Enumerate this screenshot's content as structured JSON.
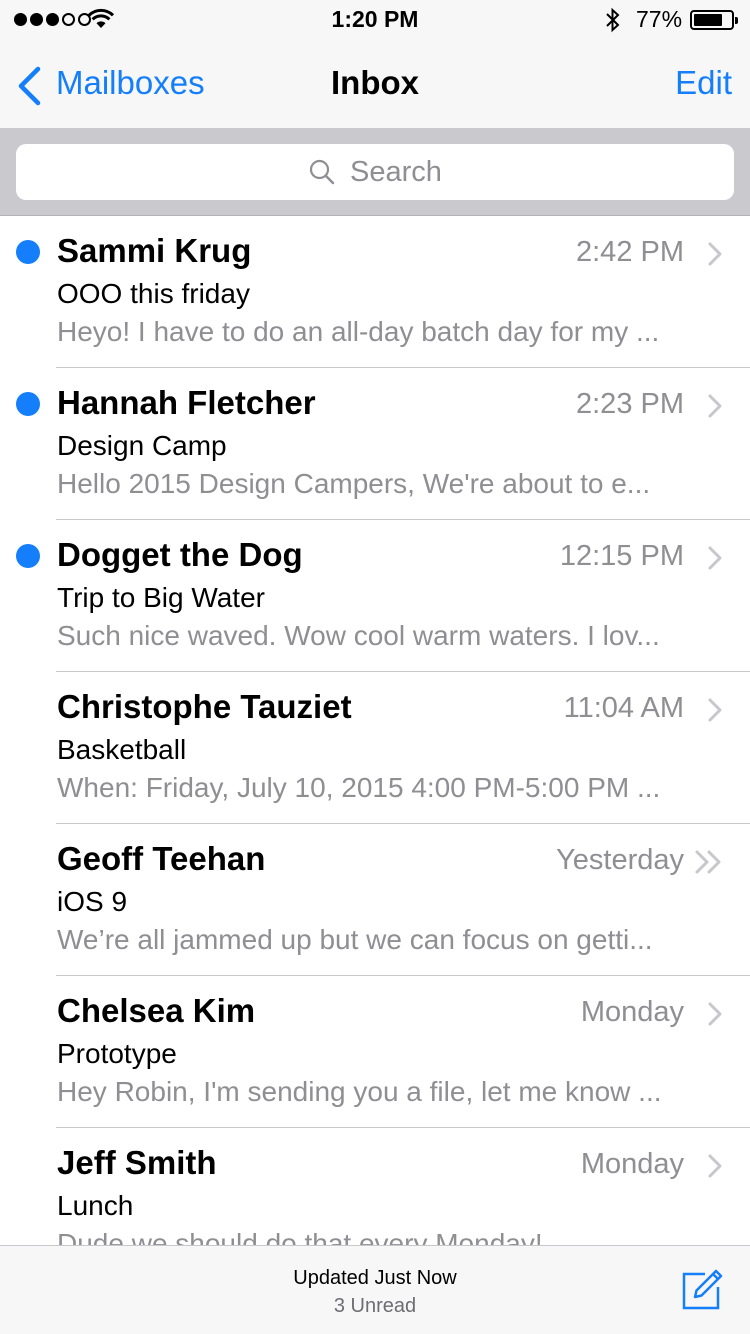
{
  "status_bar": {
    "signal_bars_filled": 3,
    "signal_bars_total": 5,
    "time": "1:20 PM",
    "battery_percent_label": "77%",
    "battery_level": 0.77,
    "icons": [
      "signal-dots",
      "wifi-icon",
      "bluetooth-icon",
      "battery-icon"
    ]
  },
  "nav": {
    "back_label": "Mailboxes",
    "title": "Inbox",
    "edit_label": "Edit"
  },
  "search": {
    "placeholder": "Search"
  },
  "messages": [
    {
      "sender": "Sammi Krug",
      "time": "2:42 PM",
      "subject": "OOO this friday",
      "preview": "Heyo! I have to do an all-day batch day for my ...",
      "unread": true,
      "chevron": "single"
    },
    {
      "sender": "Hannah Fletcher",
      "time": "2:23 PM",
      "subject": "Design Camp",
      "preview": "Hello 2015 Design Campers, We're about to e...",
      "unread": true,
      "chevron": "single"
    },
    {
      "sender": "Dogget the Dog",
      "time": "12:15 PM",
      "subject": "Trip to Big Water",
      "preview": "Such nice waved. Wow cool warm waters. I lov...",
      "unread": true,
      "chevron": "single"
    },
    {
      "sender": "Christophe Tauziet",
      "time": "11:04 AM",
      "subject": "Basketball",
      "preview": "When: Friday, July 10, 2015 4:00 PM-5:00 PM ...",
      "unread": false,
      "chevron": "single"
    },
    {
      "sender": "Geoff Teehan",
      "time": "Yesterday",
      "subject": "iOS 9",
      "preview": "We’re all jammed up but we can focus on getti...",
      "unread": false,
      "chevron": "double"
    },
    {
      "sender": "Chelsea Kim",
      "time": "Monday",
      "subject": "Prototype",
      "preview": "Hey Robin, I'm sending you a file, let me know ...",
      "unread": false,
      "chevron": "single"
    },
    {
      "sender": "Jeff Smith",
      "time": "Monday",
      "subject": "Lunch",
      "preview": "Dude we should do that every Monday!",
      "unread": false,
      "chevron": "single"
    }
  ],
  "toolbar": {
    "status": "Updated Just Now",
    "unread_count": "3 Unread",
    "compose_icon": "compose-icon"
  },
  "colors": {
    "accent": "#147efb",
    "secondary_text": "#8e8e93",
    "bar_background": "#f7f7f7",
    "search_background": "#c9c9ce"
  }
}
